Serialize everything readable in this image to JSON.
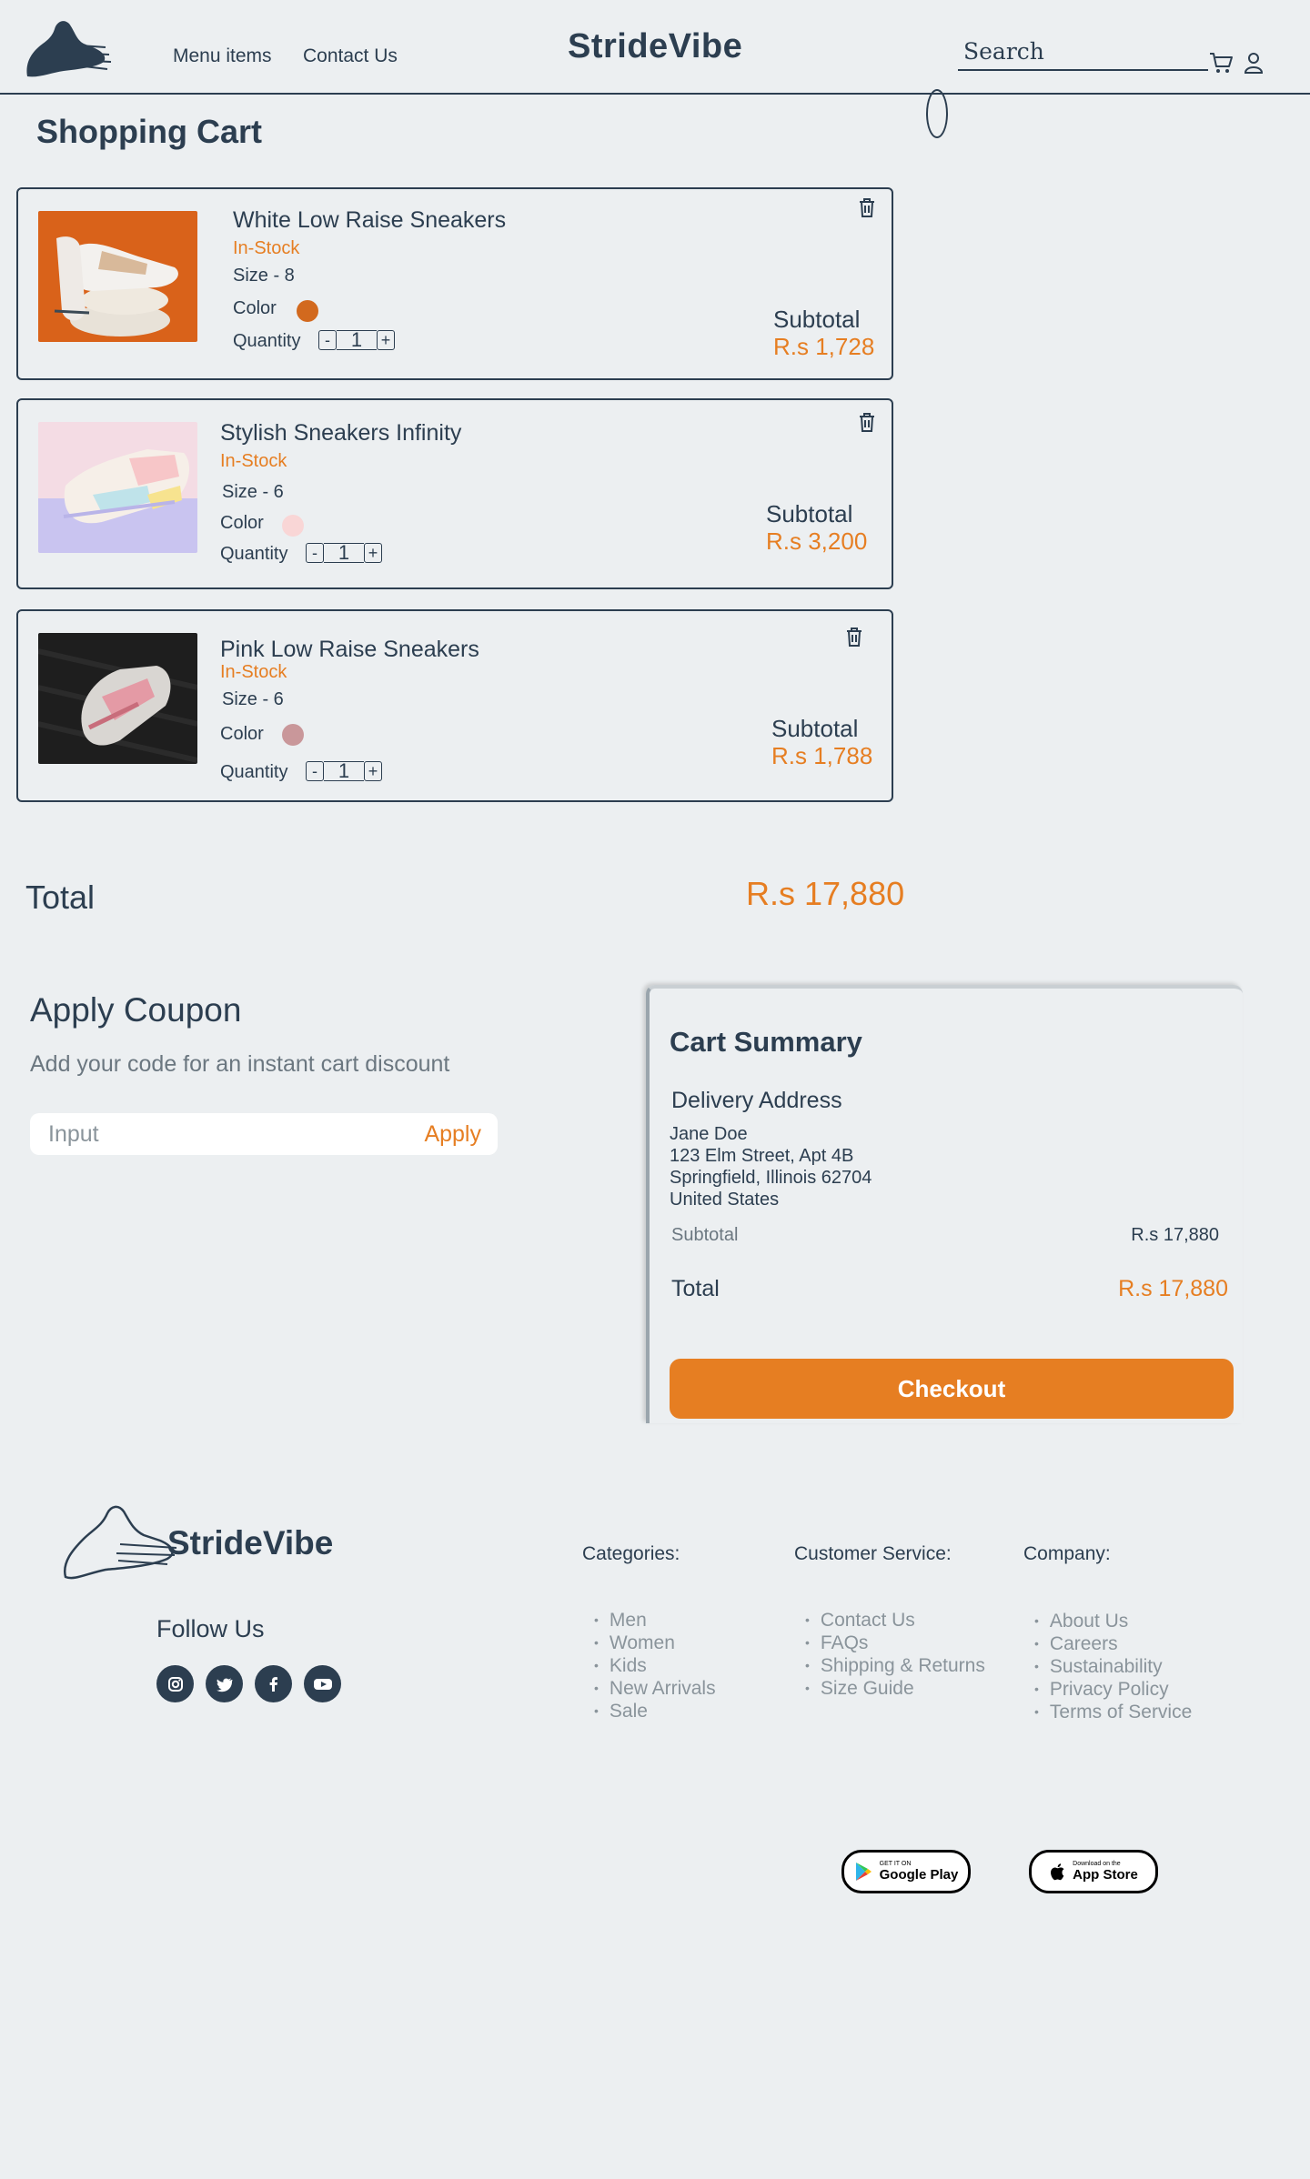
{
  "header": {
    "brand": "StrideVibe",
    "nav": [
      "Menu items",
      "Contact Us"
    ],
    "search_placeholder": "Search"
  },
  "page_title": "Shopping Cart",
  "cart": {
    "items": [
      {
        "name": "White Low Raise Sneakers",
        "stock": "In-Stock",
        "size": "Size - 8",
        "color_label": "Color",
        "color": "#d2691e",
        "quantity_label": "Quantity",
        "quantity": "1",
        "subtotal_label": "Subtotal",
        "subtotal": "R.s 1,728"
      },
      {
        "name": "Stylish Sneakers Infinity",
        "stock": "In-Stock",
        "size": "Size - 6",
        "color_label": "Color",
        "color": "#f9d6d6",
        "quantity_label": "Quantity",
        "quantity": "1",
        "subtotal_label": "Subtotal",
        "subtotal": "R.s 3,200"
      },
      {
        "name": "Pink Low Raise Sneakers",
        "stock": "In-Stock",
        "size": "Size - 6",
        "color_label": "Color",
        "color": "#c9979a",
        "quantity_label": "Quantity",
        "quantity": "1",
        "subtotal_label": "Subtotal",
        "subtotal": "R.s 1,788"
      }
    ],
    "minus": "-",
    "plus": "+"
  },
  "total": {
    "label": "Total",
    "value": "R.s 17,880"
  },
  "coupon": {
    "title": "Apply Coupon",
    "subtitle": "Add your code for an instant cart discount",
    "placeholder": "Input",
    "apply_label": "Apply"
  },
  "summary": {
    "title": "Cart Summary",
    "delivery_title": "Delivery Address",
    "address": [
      "Jane Doe",
      "123 Elm Street, Apt 4B",
      "Springfield, Illinois 62704",
      "United States"
    ],
    "subtotal_label": "Subtotal",
    "subtotal": "R.s 17,880",
    "total_label": "Total",
    "total": "R.s 17,880",
    "checkout_label": "Checkout"
  },
  "footer": {
    "brand": "StrideVibe",
    "follow_us": "Follow Us",
    "social": [
      "instagram-icon",
      "twitter-icon",
      "facebook-icon",
      "youtube-icon"
    ],
    "columns": [
      {
        "heading": "Categories:",
        "links": [
          "Men",
          "Women",
          "Kids",
          "New Arrivals",
          "Sale"
        ]
      },
      {
        "heading": "Customer Service:",
        "links": [
          "Contact Us",
          "FAQs",
          "Shipping & Returns",
          "Size Guide"
        ]
      },
      {
        "heading": "Company:",
        "links": [
          "About Us",
          "Careers",
          "Sustainability",
          "Privacy Policy",
          "Terms of Service"
        ]
      }
    ],
    "google_play": {
      "small": "GET IT ON",
      "big": "Google Play"
    },
    "app_store": {
      "small": "Download on the",
      "big": "App Store"
    }
  },
  "colors": {
    "accent": "#e67e22",
    "primary": "#2c3e50",
    "background": "#eceff1"
  }
}
